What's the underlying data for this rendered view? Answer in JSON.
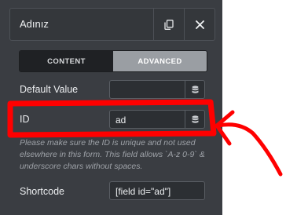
{
  "header": {
    "title": "Adınız"
  },
  "icons": {
    "copy": "copy-icon",
    "close": "close-icon",
    "dynamic": "database-icon"
  },
  "tabs": [
    {
      "label": "CONTENT",
      "active": false
    },
    {
      "label": "ADVANCED",
      "active": true
    }
  ],
  "fields": {
    "default_value": {
      "label": "Default Value",
      "value": ""
    },
    "id": {
      "label": "ID",
      "value": "ad"
    },
    "shortcode": {
      "label": "Shortcode",
      "value": "[field id=\"ad\"]"
    }
  },
  "help_text": "Please make sure the ID is unique and not used elsewhere in this form. This field allows `A-z 0-9` & underscore chars without spaces.",
  "colors": {
    "panel": "#3a3d42",
    "annotation": "#ff0000"
  }
}
